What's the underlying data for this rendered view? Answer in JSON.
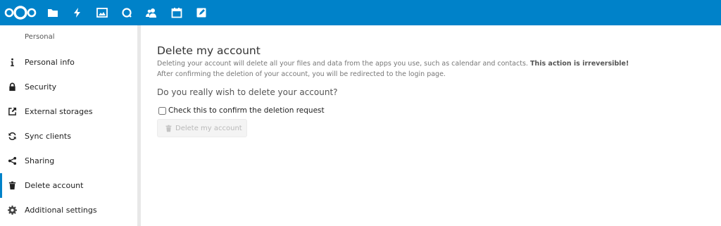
{
  "header": {
    "logo_icon": "nextcloud-logo",
    "apps": [
      {
        "name": "files",
        "icon": "folder-icon"
      },
      {
        "name": "activity",
        "icon": "lightning-icon"
      },
      {
        "name": "gallery",
        "icon": "image-icon"
      },
      {
        "name": "talk",
        "icon": "chat-bubble-icon"
      },
      {
        "name": "contacts",
        "icon": "contacts-icon"
      },
      {
        "name": "calendar",
        "icon": "calendar-icon"
      },
      {
        "name": "notes",
        "icon": "edit-note-icon"
      }
    ],
    "background_color": "#0082c9"
  },
  "sidebar": {
    "heading": "Personal",
    "items": [
      {
        "label": "Personal info",
        "icon": "info-icon"
      },
      {
        "label": "Security",
        "icon": "lock-icon"
      },
      {
        "label": "External storages",
        "icon": "external-link-icon"
      },
      {
        "label": "Sync clients",
        "icon": "sync-icon"
      },
      {
        "label": "Sharing",
        "icon": "share-icon"
      },
      {
        "label": "Delete account",
        "icon": "trash-icon",
        "active": true
      },
      {
        "label": "Additional settings",
        "icon": "gear-icon"
      }
    ]
  },
  "main": {
    "title": "Delete my account",
    "description_line1": "Deleting your account will delete all your files and data from the apps you use, such as calendar and contacts.",
    "description_emphasis": "This action is irreversible!",
    "description_line2": "After confirming the deletion of your account, you will be redirected to the login page.",
    "question": "Do you really wish to delete your account?",
    "confirm_label": "Check this to confirm the deletion request",
    "confirm_checked": false,
    "delete_button_label": "Delete my account",
    "delete_button_enabled": false
  },
  "colors": {
    "accent": "#0082c9",
    "disabled_text": "#b9b9b9"
  }
}
